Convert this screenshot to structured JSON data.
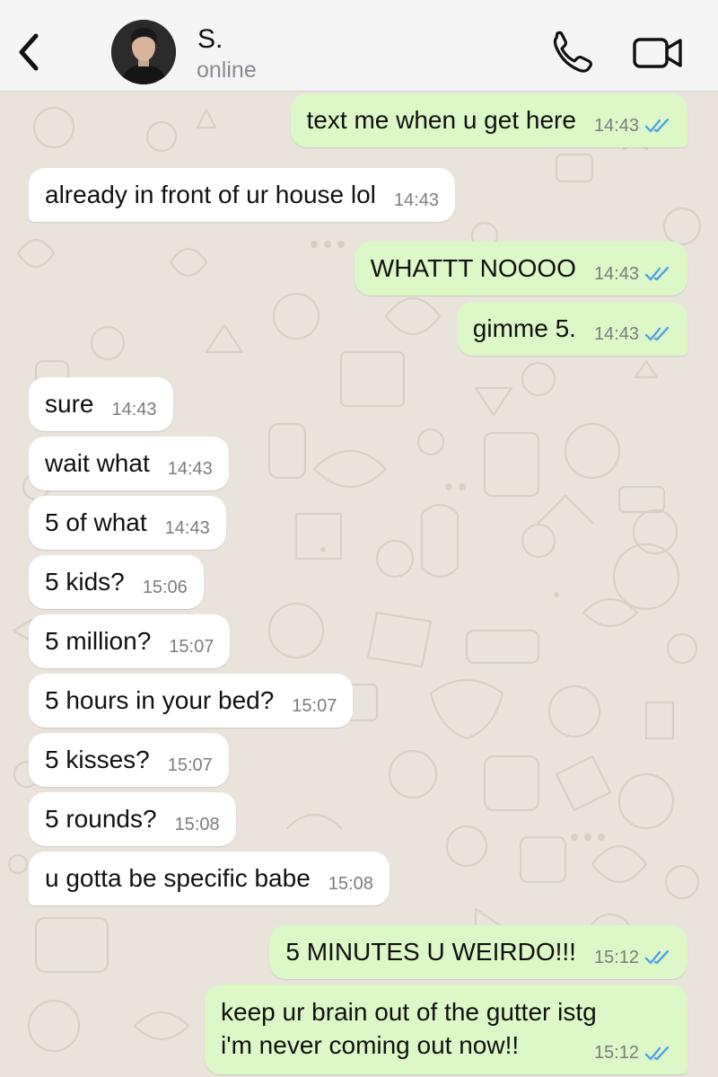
{
  "header": {
    "back_icon": "chevron-left-icon",
    "contact_name": "S.",
    "status": "online",
    "call_icon": "phone-icon",
    "video_icon": "video-camera-icon"
  },
  "colors": {
    "outgoing_bubble": "#dcf8c6",
    "incoming_bubble": "#ffffff",
    "read_ticks": "#4fa3e8",
    "wallpaper": "#e9e3dc",
    "header_bg": "#f5f5f6"
  },
  "messages": [
    {
      "direction": "outgoing",
      "text": "text me when u get here",
      "time": "14:43",
      "status": "read"
    },
    {
      "direction": "incoming",
      "text": "already in front of ur house lol",
      "time": "14:43"
    },
    {
      "direction": "outgoing",
      "text": "WHATTT NOOOO",
      "time": "14:43",
      "status": "read"
    },
    {
      "direction": "outgoing",
      "text": "gimme 5.",
      "time": "14:43",
      "status": "read"
    },
    {
      "direction": "incoming",
      "text": "sure",
      "time": "14:43"
    },
    {
      "direction": "incoming",
      "text": "wait what",
      "time": "14:43"
    },
    {
      "direction": "incoming",
      "text": "5 of what",
      "time": "14:43"
    },
    {
      "direction": "incoming",
      "text": "5 kids?",
      "time": "15:06"
    },
    {
      "direction": "incoming",
      "text": "5 million?",
      "time": "15:07"
    },
    {
      "direction": "incoming",
      "text": "5 hours in your bed?",
      "time": "15:07"
    },
    {
      "direction": "incoming",
      "text": "5 kisses?",
      "time": "15:07"
    },
    {
      "direction": "incoming",
      "text": "5 rounds?",
      "time": "15:08"
    },
    {
      "direction": "incoming",
      "text": "u gotta be specific babe",
      "time": "15:08"
    },
    {
      "direction": "outgoing",
      "text": "5 MINUTES U WEIRDO!!!",
      "time": "15:12",
      "status": "read"
    },
    {
      "direction": "outgoing",
      "lines": [
        "keep ur brain out of the gutter istg",
        "i'm never coming out now!!"
      ],
      "time": "15:12",
      "status": "read"
    }
  ]
}
